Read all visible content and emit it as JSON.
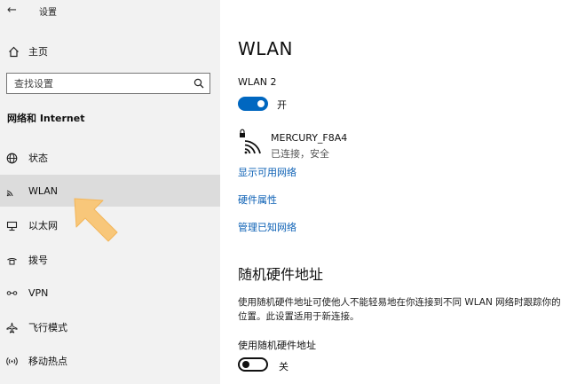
{
  "window": {
    "title": "设置",
    "back_icon": "back-arrow-icon"
  },
  "sidebar": {
    "home_label": "主页",
    "search_placeholder": "查找设置",
    "section_title": "网络和 Internet",
    "items": [
      {
        "label": "状态",
        "icon": "globe-icon"
      },
      {
        "label": "WLAN",
        "icon": "wifi-icon",
        "active": true
      },
      {
        "label": "以太网",
        "icon": "ethernet-icon"
      },
      {
        "label": "拨号",
        "icon": "dialup-icon"
      },
      {
        "label": "VPN",
        "icon": "vpn-icon"
      },
      {
        "label": "飞行模式",
        "icon": "airplane-icon"
      },
      {
        "label": "移动热点",
        "icon": "hotspot-icon"
      }
    ]
  },
  "main": {
    "title": "WLAN",
    "adapter_name": "WLAN 2",
    "wlan_toggle": {
      "state": "开",
      "on": true
    },
    "network": {
      "ssid": "MERCURY_F8A4",
      "status": "已连接，安全"
    },
    "links": [
      "显示可用网络",
      "硬件属性",
      "管理已知网络"
    ],
    "random_hw": {
      "heading": "随机硬件地址",
      "description": "使用随机硬件地址可使他人不能轻易地在你连接到不同 WLAN 网络时跟踪你的位置。此设置适用于新连接。",
      "label": "使用随机硬件地址",
      "toggle": {
        "state": "关",
        "on": false
      }
    }
  },
  "colors": {
    "accent": "#0067c0",
    "link": "#0a5fb4",
    "sidebar_bg": "#f2f2f2",
    "active_item_bg": "#dcdcdc",
    "arrow": "#f8c77a"
  }
}
